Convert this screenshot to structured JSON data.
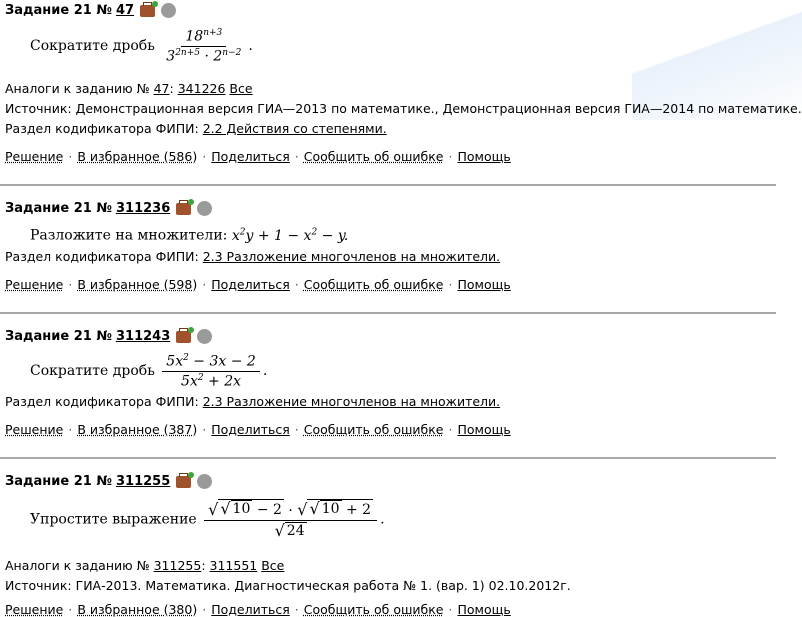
{
  "tasks": [
    {
      "title": "Задание 21 №",
      "number": "47",
      "prompt": "Сократите дробь",
      "analogs_label": "Аналоги к заданию №",
      "analogs_main": "47",
      "analogs_sep": ":",
      "analogs_list": [
        "341226"
      ],
      "analogs_all": "Все",
      "source": "Источник: Демонстрационная версия ГИА—2013 по математике., Демонстрационная версия ГИА—2014 по математике.",
      "section_label": "Раздел кодификатора ФИПИ:",
      "section_link": "2.2 Действия со степенями.",
      "actions": {
        "solution": "Решение",
        "favorite": "В избранное (586)",
        "share": "Поделиться",
        "report": "Сообщить об ошибке",
        "help": "Помощь"
      }
    },
    {
      "title": "Задание 21 №",
      "number": "311236",
      "prompt": "Разложите на множители:",
      "section_label": "Раздел кодификатора ФИПИ:",
      "section_link": "2.3 Разложение многочленов на множители.",
      "actions": {
        "solution": "Решение",
        "favorite": "В избранное (598)",
        "share": "Поделиться",
        "report": "Сообщить об ошибке",
        "help": "Помощь"
      }
    },
    {
      "title": "Задание 21 №",
      "number": "311243",
      "prompt": "Сократите дробь",
      "section_label": "Раздел кодификатора ФИПИ:",
      "section_link": "2.3 Разложение многочленов на множители.",
      "actions": {
        "solution": "Решение",
        "favorite": "В избранное (387)",
        "share": "Поделиться",
        "report": "Сообщить об ошибке",
        "help": "Помощь"
      }
    },
    {
      "title": "Задание 21 №",
      "number": "311255",
      "prompt": "Упростите выражение",
      "analogs_label": "Аналоги к заданию №",
      "analogs_main": "311255",
      "analogs_sep": ":",
      "analogs_list": [
        "311551"
      ],
      "analogs_all": "Все",
      "source": "Источник: ГИА-2013. Математика. Диагностическая работа № 1. (вар. 1) 02.10.2012г.",
      "actions": {
        "solution": "Решение",
        "favorite": "В избранное (380)",
        "share": "Поделиться",
        "report": "Сообщить об ошибке",
        "help": "Помощь"
      }
    }
  ],
  "colors": {
    "divider": "#a8a8a8",
    "briefcase": "#a0522d",
    "status_circle": "#9a9a9a"
  },
  "icons": {
    "briefcase": "briefcase-icon",
    "status": "status-circle-icon"
  }
}
